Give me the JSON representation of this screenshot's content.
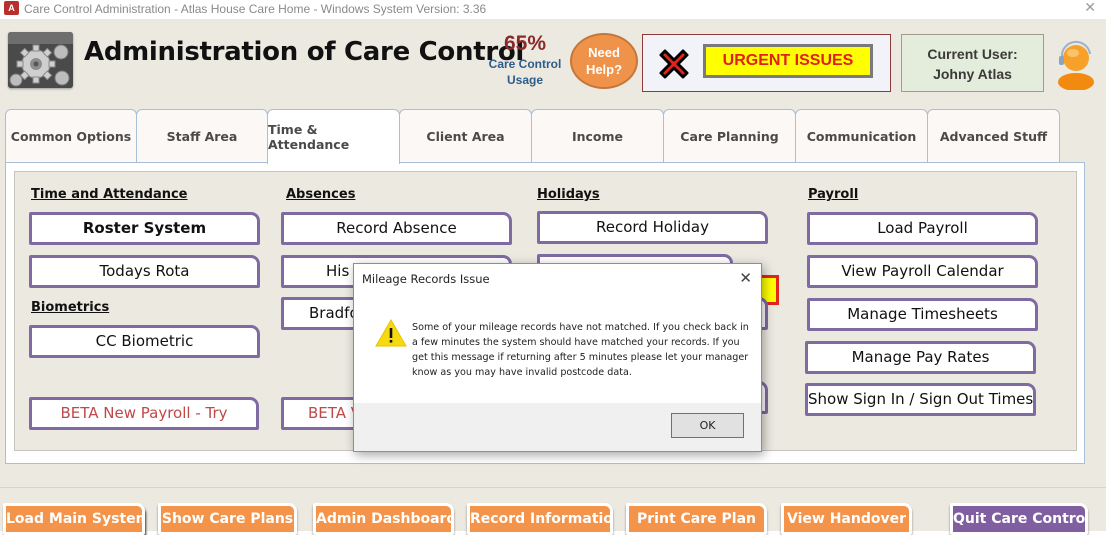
{
  "window": {
    "title": "Care Control Administration - Atlas House Care Home - Windows System Version: 3.36",
    "app_icon_letter": "A",
    "close_glyph": "✕"
  },
  "header": {
    "title": "Administration of Care Control",
    "usage_percent": "65%",
    "usage_label_line1": "Care Control",
    "usage_label_line2": "Usage",
    "help_line1": "Need",
    "help_line2": "Help?",
    "urgent_label": "URGENT ISSUES",
    "user_label": "Current User:",
    "user_name": "Johny Atlas"
  },
  "tabs": [
    {
      "label": "Common Options",
      "active": false
    },
    {
      "label": "Staff Area",
      "active": false
    },
    {
      "label": "Time & Attendance",
      "active": true
    },
    {
      "label": "Client Area",
      "active": false
    },
    {
      "label": "Income",
      "active": false
    },
    {
      "label": "Care Planning",
      "active": false
    },
    {
      "label": "Communication",
      "active": false
    },
    {
      "label": "Advanced Stuff",
      "active": false
    }
  ],
  "sections": {
    "time_attendance": {
      "heading": "Time and Attendance",
      "buttons": [
        "Roster System",
        "Todays Rota"
      ]
    },
    "biometrics": {
      "heading": "Biometrics",
      "buttons": [
        "CC Biometric"
      ]
    },
    "beta_left": "BETA New Payroll - Try",
    "absences": {
      "heading": "Absences",
      "buttons": [
        "Record Absence",
        "His",
        "Bradfo"
      ]
    },
    "beta_mid": "BETA V",
    "holidays": {
      "heading": "Holidays",
      "buttons": [
        "Record Holiday"
      ]
    },
    "payroll": {
      "heading": "Payroll",
      "buttons": [
        "Load Payroll",
        "View Payroll Calendar",
        "Manage Timesheets",
        "Manage Pay Rates",
        "Show Sign In / Sign Out Times"
      ]
    }
  },
  "bottom_buttons": [
    "Load Main System",
    "Show Care Plans",
    "Admin Dashboard",
    "Record Information",
    "Print Care Plan",
    "View Handover",
    "Quit Care Control"
  ],
  "dialog": {
    "title": "Mileage Records Issue",
    "close_glyph": "✕",
    "message": "Some of your mileage records have not matched.  If you check back in a few minutes the system should have matched your records.  If you get this message if returning after 5 minutes please let your manager know as you may have invalid postcode data.",
    "ok_label": "OK"
  },
  "colors": {
    "button_border": "#7f6aa2",
    "orange": "#f3944a",
    "quit_purple": "#7f5fa0",
    "urgent_yellow": "#ffff00",
    "urgent_red": "#e0211a"
  }
}
